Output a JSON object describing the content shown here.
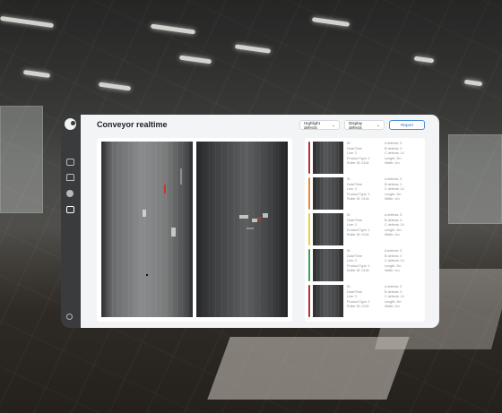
{
  "app": {
    "title": "Conveyor realtime"
  },
  "toolbar": {
    "highlight_label": "Highlight defects",
    "display_label": "Display defects",
    "report_label": "Report"
  },
  "sidebar": {
    "items": [
      {
        "icon": "monitor-icon"
      },
      {
        "icon": "home-icon"
      },
      {
        "icon": "circle-icon"
      },
      {
        "icon": "camera-icon",
        "active": true
      }
    ],
    "bottom_icon": "settings-icon"
  },
  "defects": [
    {
      "status_color": "#b0333c",
      "id": "ID",
      "datetime": "Date/Time",
      "line": "Line: 2",
      "product_type": "Product Type: 1",
      "roller": "Roller ID: 0134",
      "a_defects": "A defects: 0",
      "b_defects": "B defects: 0",
      "c_defects": "C defects: 14",
      "length": "Length: 2m",
      "width": "Width: 1m"
    },
    {
      "status_color": "#e08a3c",
      "id": "ID",
      "datetime": "Date/Time",
      "line": "Line: 2",
      "product_type": "Product Type: 1",
      "roller": "Roller ID: 0134",
      "a_defects": "A defects: 0",
      "b_defects": "B defects: 0",
      "c_defects": "C defects: 14",
      "length": "Length: 2m",
      "width": "Width: 1m"
    },
    {
      "status_color": "#e6d04a",
      "id": "ID",
      "datetime": "Date/Time",
      "line": "Line: 2",
      "product_type": "Product Type: 1",
      "roller": "Roller ID: 0134",
      "a_defects": "A defects: 5",
      "b_defects": "B defects: 4",
      "c_defects": "C defects: 14",
      "length": "Length: 2m",
      "width": "Width: 1m"
    },
    {
      "status_color": "#3fa05a",
      "id": "ID",
      "datetime": "Date/Time",
      "line": "Line: 2",
      "product_type": "Product Type: 1",
      "roller": "Roller ID: 0134",
      "a_defects": "A defects: 0",
      "b_defects": "B defects: 2",
      "c_defects": "C defects: 14",
      "length": "Length: 2m",
      "width": "Width: 1m"
    },
    {
      "status_color": "#b0333c",
      "id": "ID",
      "datetime": "Date/Time",
      "line": "Line: 2",
      "product_type": "Product Type: 1",
      "roller": "Roller ID: 0134",
      "a_defects": "A defects: 0",
      "b_defects": "B defects: 0",
      "c_defects": "C defects: 14",
      "length": "Length: 2m",
      "width": "Width: 1m"
    }
  ]
}
